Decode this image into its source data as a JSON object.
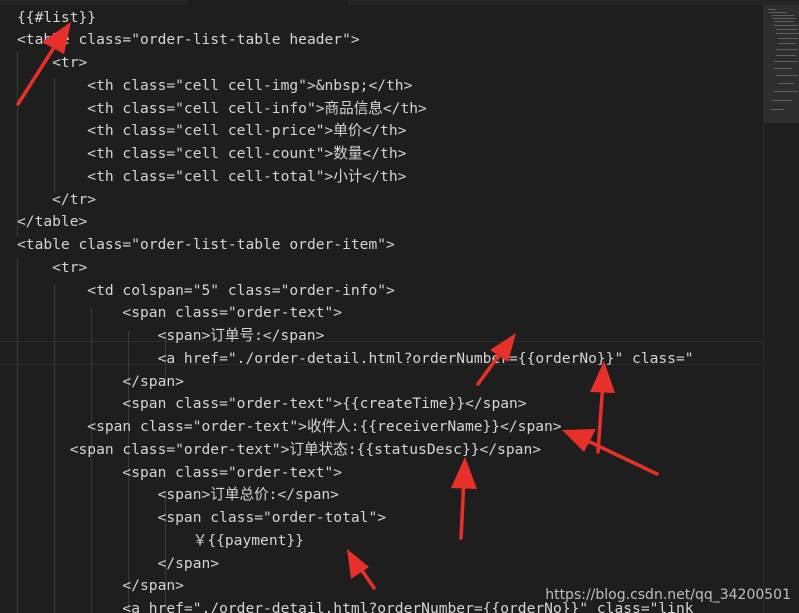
{
  "code_lines": [
    "{{#list}}",
    "<table class=\"order-list-table header\">",
    "    <tr>",
    "        <th class=\"cell cell-img\">&nbsp;</th>",
    "        <th class=\"cell cell-info\">商品信息</th>",
    "        <th class=\"cell cell-price\">单价</th>",
    "        <th class=\"cell cell-count\">数量</th>",
    "        <th class=\"cell cell-total\">小计</th>",
    "    </tr>",
    "</table>",
    "<table class=\"order-list-table order-item\">",
    "    <tr>",
    "        <td colspan=\"5\" class=\"order-info\">",
    "            <span class=\"order-text\">",
    "                <span>订单号:</span>",
    "                <a href=\"./order-detail.html?orderNumber={{orderNo}}\" class=\"",
    "            </span>",
    "            <span class=\"order-text\">{{createTime}}</span>",
    "        <span class=\"order-text\">收件人:{{receiverName}}</span>",
    "      <span class=\"order-text\">订单状态:{{statusDesc}}</span>",
    "            <span class=\"order-text\">",
    "                <span>订单总价:</span>",
    "                <span class=\"order-total\">",
    "                    ￥{{payment}}",
    "                </span>",
    "            </span>",
    "            <a href=\"./order-detail.html?orderNumber={{orderNo}}\" class=\"link"
  ],
  "watermark": "https://blog.csdn.net/qq_34200501",
  "colors": {
    "background": "#1e1e1e",
    "text": "#d4d4d4",
    "annotation_arrow": "#e8302a"
  }
}
